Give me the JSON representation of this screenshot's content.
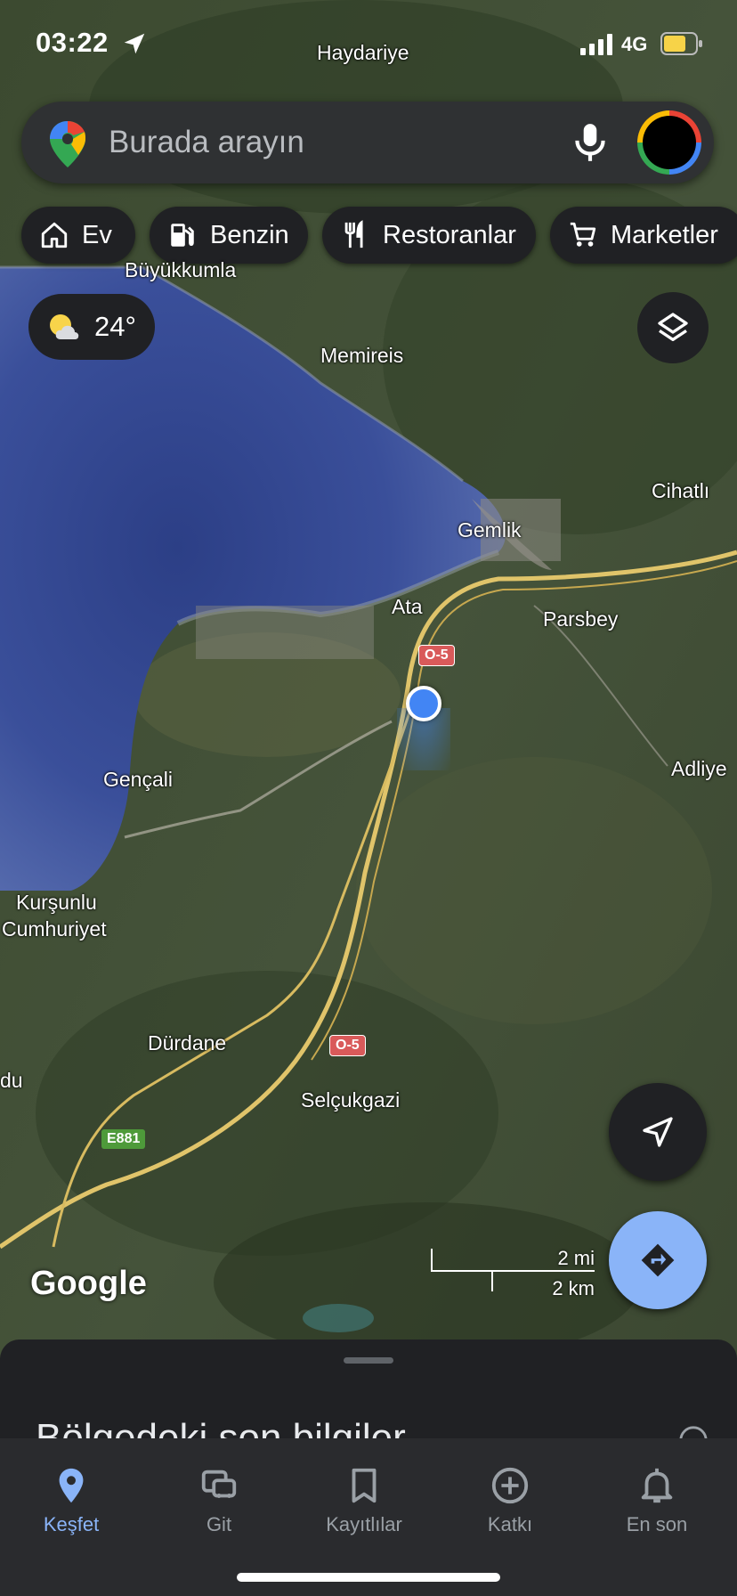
{
  "status_bar": {
    "time": "03:22",
    "network": "4G"
  },
  "search": {
    "placeholder": "Burada arayın"
  },
  "chips": [
    {
      "label": "Ev",
      "icon": "home-icon"
    },
    {
      "label": "Benzin",
      "icon": "gas-station-icon"
    },
    {
      "label": "Restoranlar",
      "icon": "restaurant-icon"
    },
    {
      "label": "Marketler",
      "icon": "cart-icon"
    }
  ],
  "weather": {
    "temp": "24°",
    "icon": "partly-cloudy-icon"
  },
  "map_labels": {
    "haydariye": "Haydariye",
    "buyukkumla": "Büyükkumla",
    "memireis": "Memireis",
    "cihatli": "Cihatlı",
    "gemlik": "Gemlik",
    "ata": "Ata",
    "parsbey": "Parsbey",
    "adliye": "Adliye",
    "gencali": "Gençali",
    "kursunlu": "Kurşunlu",
    "cumhuriyet": "Cumhuriyet",
    "durdane": "Dürdane",
    "du": "du",
    "selcukgazi": "Selçukgazi"
  },
  "road_shields": {
    "o5": "O-5",
    "e881": "E881"
  },
  "attribution": "Google",
  "scale": {
    "mi": "2 mi",
    "km": "2 km"
  },
  "sheet": {
    "title": "Bölgedeki son bilgiler"
  },
  "tabs": [
    {
      "label": "Keşfet",
      "icon": "explore-pin-icon",
      "active": true
    },
    {
      "label": "Git",
      "icon": "commute-icon"
    },
    {
      "label": "Kayıtlılar",
      "icon": "bookmark-icon"
    },
    {
      "label": "Katkı",
      "icon": "add-circle-icon"
    },
    {
      "label": "En son",
      "icon": "bell-icon"
    }
  ],
  "colors": {
    "accent": "#8ab4f8",
    "location": "#4285f4",
    "chip_bg": "#202124",
    "road_shield": "#d95a5a"
  }
}
